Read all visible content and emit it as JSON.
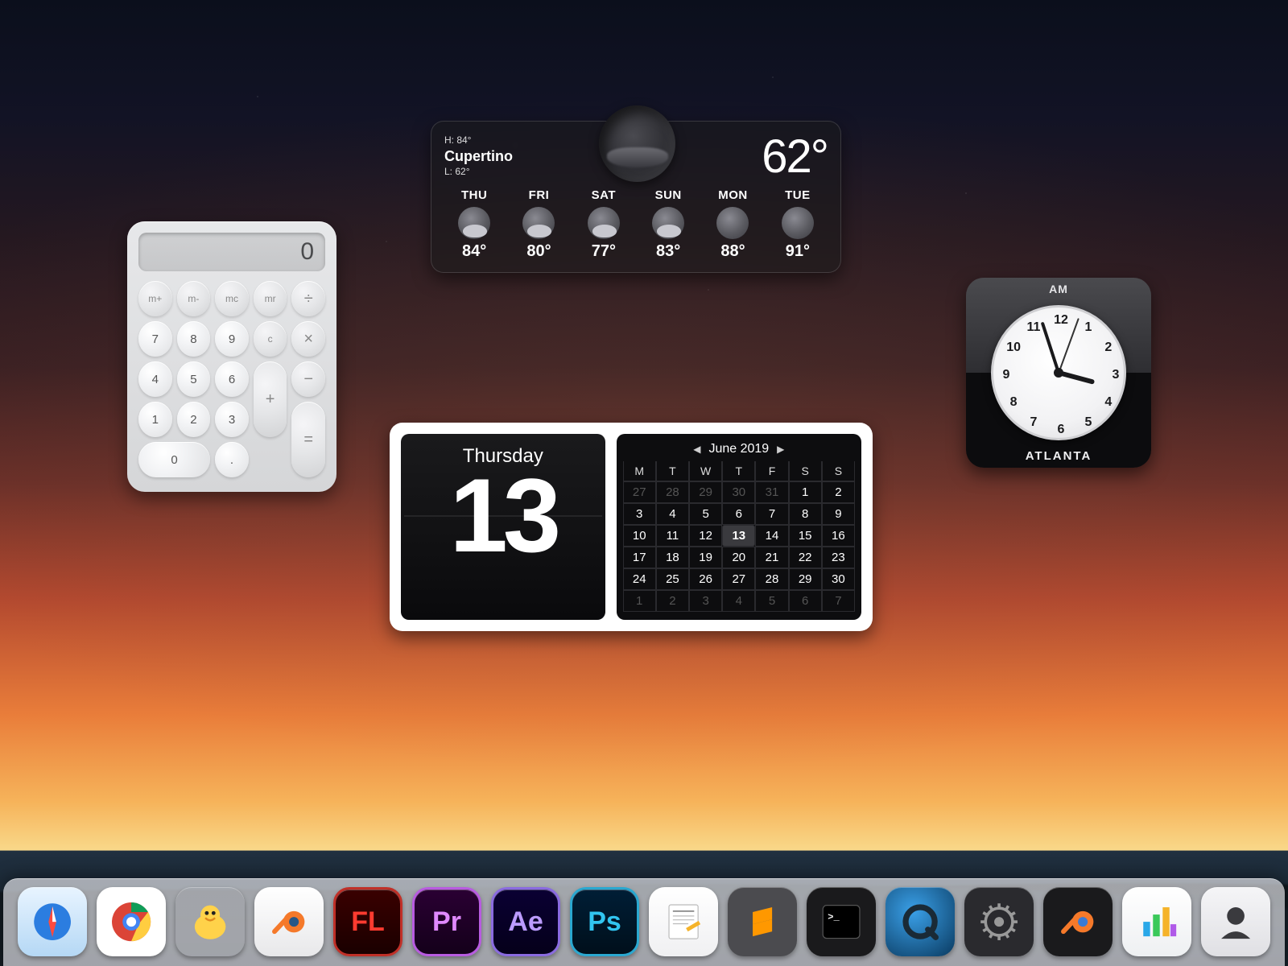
{
  "calculator": {
    "display": "0",
    "keys": {
      "mplus": "m+",
      "mminus": "m-",
      "mc": "mc",
      "mr": "mr",
      "div": "÷",
      "k7": "7",
      "k8": "8",
      "k9": "9",
      "mul": "×",
      "k4": "4",
      "k5": "5",
      "k6": "6",
      "sub": "−",
      "k1": "1",
      "k2": "2",
      "k3": "3",
      "add": "+",
      "k0": "0",
      "dot": ".",
      "c": "c",
      "eq": "="
    }
  },
  "weather": {
    "high_label": "H: 84°",
    "city": "Cupertino",
    "low_label": "L: 62°",
    "current_temp": "62°",
    "days": [
      {
        "label": "THU",
        "temp": "84°",
        "cond": "partly-cloudy"
      },
      {
        "label": "FRI",
        "temp": "80°",
        "cond": "partly-cloudy"
      },
      {
        "label": "SAT",
        "temp": "77°",
        "cond": "partly-cloudy"
      },
      {
        "label": "SUN",
        "temp": "83°",
        "cond": "partly-cloudy"
      },
      {
        "label": "MON",
        "temp": "88°",
        "cond": "clear"
      },
      {
        "label": "TUE",
        "temp": "91°",
        "cond": "clear"
      }
    ]
  },
  "clock": {
    "ampm": "AM",
    "city": "ATLANTA",
    "hour_angle": 105,
    "minute_angle": 342,
    "second_angle": 20,
    "numerals": [
      "12",
      "1",
      "2",
      "3",
      "4",
      "5",
      "6",
      "7",
      "8",
      "9",
      "10",
      "11"
    ]
  },
  "calendar": {
    "day_of_week": "Thursday",
    "day_number": "13",
    "month_label": "June 2019",
    "prev": "◀",
    "next": "▶",
    "weekday_headers": [
      "M",
      "T",
      "W",
      "T",
      "F",
      "S",
      "S"
    ],
    "cells": [
      {
        "n": "27",
        "dim": true
      },
      {
        "n": "28",
        "dim": true
      },
      {
        "n": "29",
        "dim": true
      },
      {
        "n": "30",
        "dim": true
      },
      {
        "n": "31",
        "dim": true
      },
      {
        "n": "1"
      },
      {
        "n": "2"
      },
      {
        "n": "3"
      },
      {
        "n": "4"
      },
      {
        "n": "5"
      },
      {
        "n": "6"
      },
      {
        "n": "7"
      },
      {
        "n": "8"
      },
      {
        "n": "9"
      },
      {
        "n": "10"
      },
      {
        "n": "11"
      },
      {
        "n": "12"
      },
      {
        "n": "13",
        "sel": true
      },
      {
        "n": "14"
      },
      {
        "n": "15"
      },
      {
        "n": "16"
      },
      {
        "n": "17"
      },
      {
        "n": "18"
      },
      {
        "n": "19"
      },
      {
        "n": "20"
      },
      {
        "n": "21"
      },
      {
        "n": "22"
      },
      {
        "n": "23"
      },
      {
        "n": "24"
      },
      {
        "n": "25"
      },
      {
        "n": "26"
      },
      {
        "n": "27"
      },
      {
        "n": "28"
      },
      {
        "n": "29"
      },
      {
        "n": "30"
      },
      {
        "n": "1",
        "dim": true
      },
      {
        "n": "2",
        "dim": true
      },
      {
        "n": "3",
        "dim": true
      },
      {
        "n": "4",
        "dim": true
      },
      {
        "n": "5",
        "dim": true
      },
      {
        "n": "6",
        "dim": true
      },
      {
        "n": "7",
        "dim": true
      }
    ]
  },
  "dock": {
    "apps": [
      {
        "name": "safari",
        "label": "Safari"
      },
      {
        "name": "chrome",
        "label": "Google Chrome"
      },
      {
        "name": "cyberduck",
        "label": "Cyberduck"
      },
      {
        "name": "blender",
        "label": "Blender"
      },
      {
        "name": "flash",
        "label": "FL"
      },
      {
        "name": "premiere",
        "label": "Pr"
      },
      {
        "name": "aftereffects",
        "label": "Ae"
      },
      {
        "name": "photoshop",
        "label": "Ps"
      },
      {
        "name": "textedit",
        "label": "TextEdit"
      },
      {
        "name": "sublime",
        "label": "Sublime Text"
      },
      {
        "name": "terminal",
        "label": "Terminal"
      },
      {
        "name": "quicktime",
        "label": "QuickTime"
      },
      {
        "name": "settings",
        "label": "System Preferences"
      },
      {
        "name": "blender2",
        "label": "Blender"
      },
      {
        "name": "numbers",
        "label": "Numbers"
      },
      {
        "name": "contact",
        "label": "Contact"
      }
    ]
  }
}
